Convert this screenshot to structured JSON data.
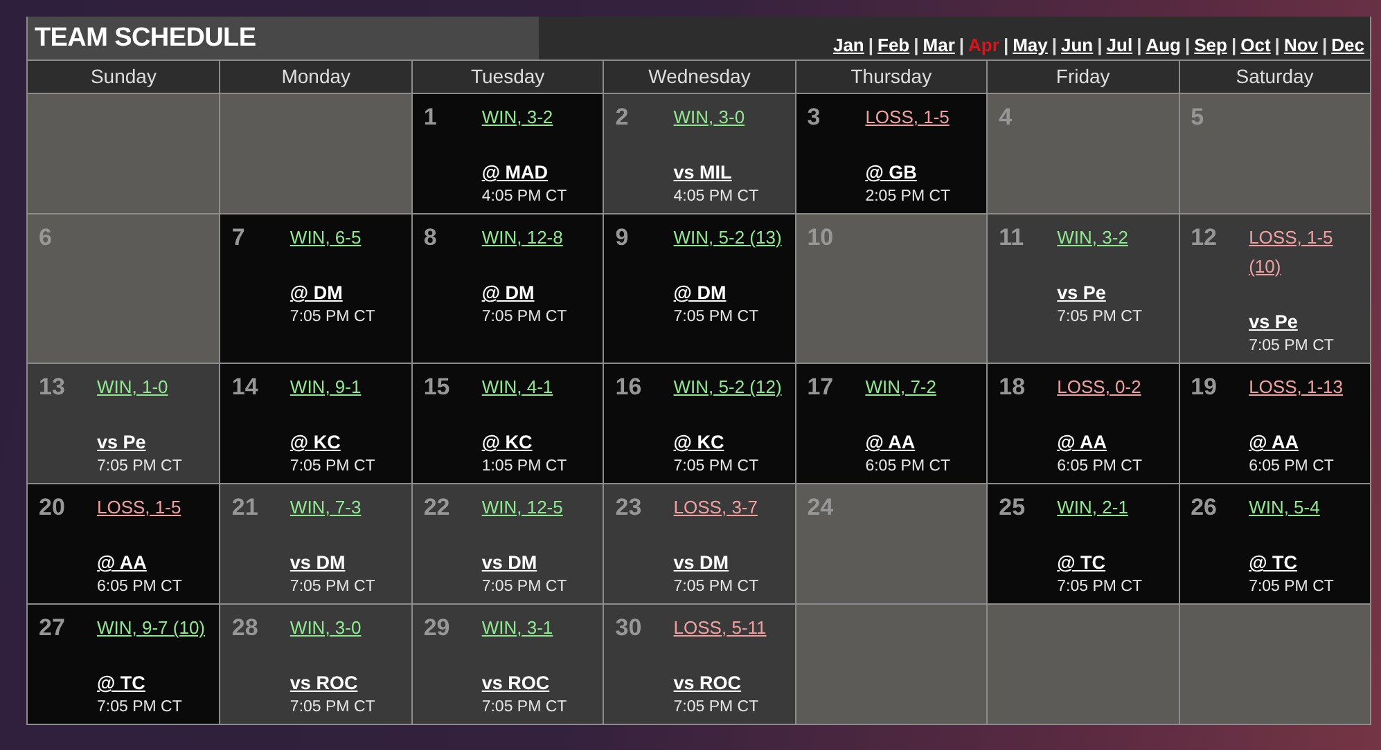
{
  "title": "TEAM SCHEDULE",
  "months": [
    {
      "label": "Jan",
      "selected": false
    },
    {
      "label": "Feb",
      "selected": false
    },
    {
      "label": "Mar",
      "selected": false
    },
    {
      "label": "Apr",
      "selected": true
    },
    {
      "label": "May",
      "selected": false
    },
    {
      "label": "Jun",
      "selected": false
    },
    {
      "label": "Jul",
      "selected": false
    },
    {
      "label": "Aug",
      "selected": false
    },
    {
      "label": "Sep",
      "selected": false
    },
    {
      "label": "Oct",
      "selected": false
    },
    {
      "label": "Nov",
      "selected": false
    },
    {
      "label": "Dec",
      "selected": false
    }
  ],
  "month_separators": [
    "|",
    "|",
    "|",
    "|",
    "|",
    "|",
    "|",
    "|",
    "|",
    "|",
    "|"
  ],
  "weekdays": [
    "Sunday",
    "Monday",
    "Tuesday",
    "Wednesday",
    "Thursday",
    "Friday",
    "Saturday"
  ],
  "weeks": [
    [
      {
        "kind": "blank"
      },
      {
        "kind": "blank"
      },
      {
        "kind": "away",
        "day": "1",
        "result": {
          "kind": "win",
          "text": "WIN, 3-2"
        },
        "opponent": "@ MAD",
        "time": "4:05 PM CT"
      },
      {
        "kind": "home",
        "day": "2",
        "result": {
          "kind": "win",
          "text": "WIN, 3-0"
        },
        "opponent": "vs MIL",
        "time": "4:05 PM CT"
      },
      {
        "kind": "away",
        "day": "3",
        "result": {
          "kind": "loss",
          "text": "LOSS, 1-5"
        },
        "opponent": "@ GB",
        "time": "2:05 PM CT"
      },
      {
        "kind": "off",
        "day": "4"
      },
      {
        "kind": "off",
        "day": "5"
      }
    ],
    [
      {
        "kind": "off",
        "day": "6"
      },
      {
        "kind": "away",
        "day": "7",
        "result": {
          "kind": "win",
          "text": "WIN, 6-5"
        },
        "opponent": "@ DM",
        "time": "7:05 PM CT"
      },
      {
        "kind": "away",
        "day": "8",
        "result": {
          "kind": "win",
          "text": "WIN, 12-8"
        },
        "opponent": "@ DM",
        "time": "7:05 PM CT"
      },
      {
        "kind": "away",
        "day": "9",
        "result": {
          "kind": "win",
          "text": "WIN, 5-2 (13)"
        },
        "opponent": "@ DM",
        "time": "7:05 PM CT"
      },
      {
        "kind": "off",
        "day": "10"
      },
      {
        "kind": "home",
        "day": "11",
        "result": {
          "kind": "win",
          "text": "WIN, 3-2"
        },
        "opponent": "vs Pe",
        "time": "7:05 PM CT"
      },
      {
        "kind": "home",
        "day": "12",
        "result": {
          "kind": "loss",
          "text": "LOSS, 1-5 (10)"
        },
        "opponent": "vs Pe",
        "time": "7:05 PM CT"
      }
    ],
    [
      {
        "kind": "home",
        "day": "13",
        "result": {
          "kind": "win",
          "text": "WIN, 1-0"
        },
        "opponent": "vs Pe",
        "time": "7:05 PM CT"
      },
      {
        "kind": "away",
        "day": "14",
        "result": {
          "kind": "win",
          "text": "WIN, 9-1"
        },
        "opponent": "@ KC",
        "time": "7:05 PM CT"
      },
      {
        "kind": "away",
        "day": "15",
        "result": {
          "kind": "win",
          "text": "WIN, 4-1"
        },
        "opponent": "@ KC",
        "time": "1:05 PM CT"
      },
      {
        "kind": "away",
        "day": "16",
        "result": {
          "kind": "win",
          "text": "WIN, 5-2 (12)"
        },
        "opponent": "@ KC",
        "time": "7:05 PM CT"
      },
      {
        "kind": "away",
        "day": "17",
        "result": {
          "kind": "win",
          "text": "WIN, 7-2"
        },
        "opponent": "@ AA",
        "time": "6:05 PM CT"
      },
      {
        "kind": "away",
        "day": "18",
        "result": {
          "kind": "loss",
          "text": "LOSS, 0-2"
        },
        "opponent": "@ AA",
        "time": "6:05 PM CT"
      },
      {
        "kind": "away",
        "day": "19",
        "result": {
          "kind": "loss",
          "text": "LOSS, 1-13"
        },
        "opponent": "@ AA",
        "time": "6:05 PM CT"
      }
    ],
    [
      {
        "kind": "away",
        "day": "20",
        "result": {
          "kind": "loss",
          "text": "LOSS, 1-5"
        },
        "opponent": "@ AA",
        "time": "6:05 PM CT"
      },
      {
        "kind": "home",
        "day": "21",
        "result": {
          "kind": "win",
          "text": "WIN, 7-3"
        },
        "opponent": "vs DM",
        "time": "7:05 PM CT"
      },
      {
        "kind": "home",
        "day": "22",
        "result": {
          "kind": "win",
          "text": "WIN, 12-5"
        },
        "opponent": "vs DM",
        "time": "7:05 PM CT"
      },
      {
        "kind": "home",
        "day": "23",
        "result": {
          "kind": "loss",
          "text": "LOSS, 3-7"
        },
        "opponent": "vs DM",
        "time": "7:05 PM CT"
      },
      {
        "kind": "off",
        "day": "24"
      },
      {
        "kind": "away",
        "day": "25",
        "result": {
          "kind": "win",
          "text": "WIN, 2-1"
        },
        "opponent": "@ TC",
        "time": "7:05 PM CT"
      },
      {
        "kind": "away",
        "day": "26",
        "result": {
          "kind": "win",
          "text": "WIN, 5-4"
        },
        "opponent": "@ TC",
        "time": "7:05 PM CT"
      }
    ],
    [
      {
        "kind": "away",
        "day": "27",
        "result": {
          "kind": "win",
          "text": "WIN, 9-7 (10)"
        },
        "opponent": "@ TC",
        "time": "7:05 PM CT"
      },
      {
        "kind": "home",
        "day": "28",
        "result": {
          "kind": "win",
          "text": "WIN, 3-0"
        },
        "opponent": "vs ROC",
        "time": "7:05 PM CT"
      },
      {
        "kind": "home",
        "day": "29",
        "result": {
          "kind": "win",
          "text": "WIN, 3-1"
        },
        "opponent": "vs ROC",
        "time": "7:05 PM CT"
      },
      {
        "kind": "home",
        "day": "30",
        "result": {
          "kind": "loss",
          "text": "LOSS, 5-11"
        },
        "opponent": "vs ROC",
        "time": "7:05 PM CT"
      },
      {
        "kind": "blank"
      },
      {
        "kind": "blank"
      },
      {
        "kind": "blank"
      }
    ]
  ]
}
